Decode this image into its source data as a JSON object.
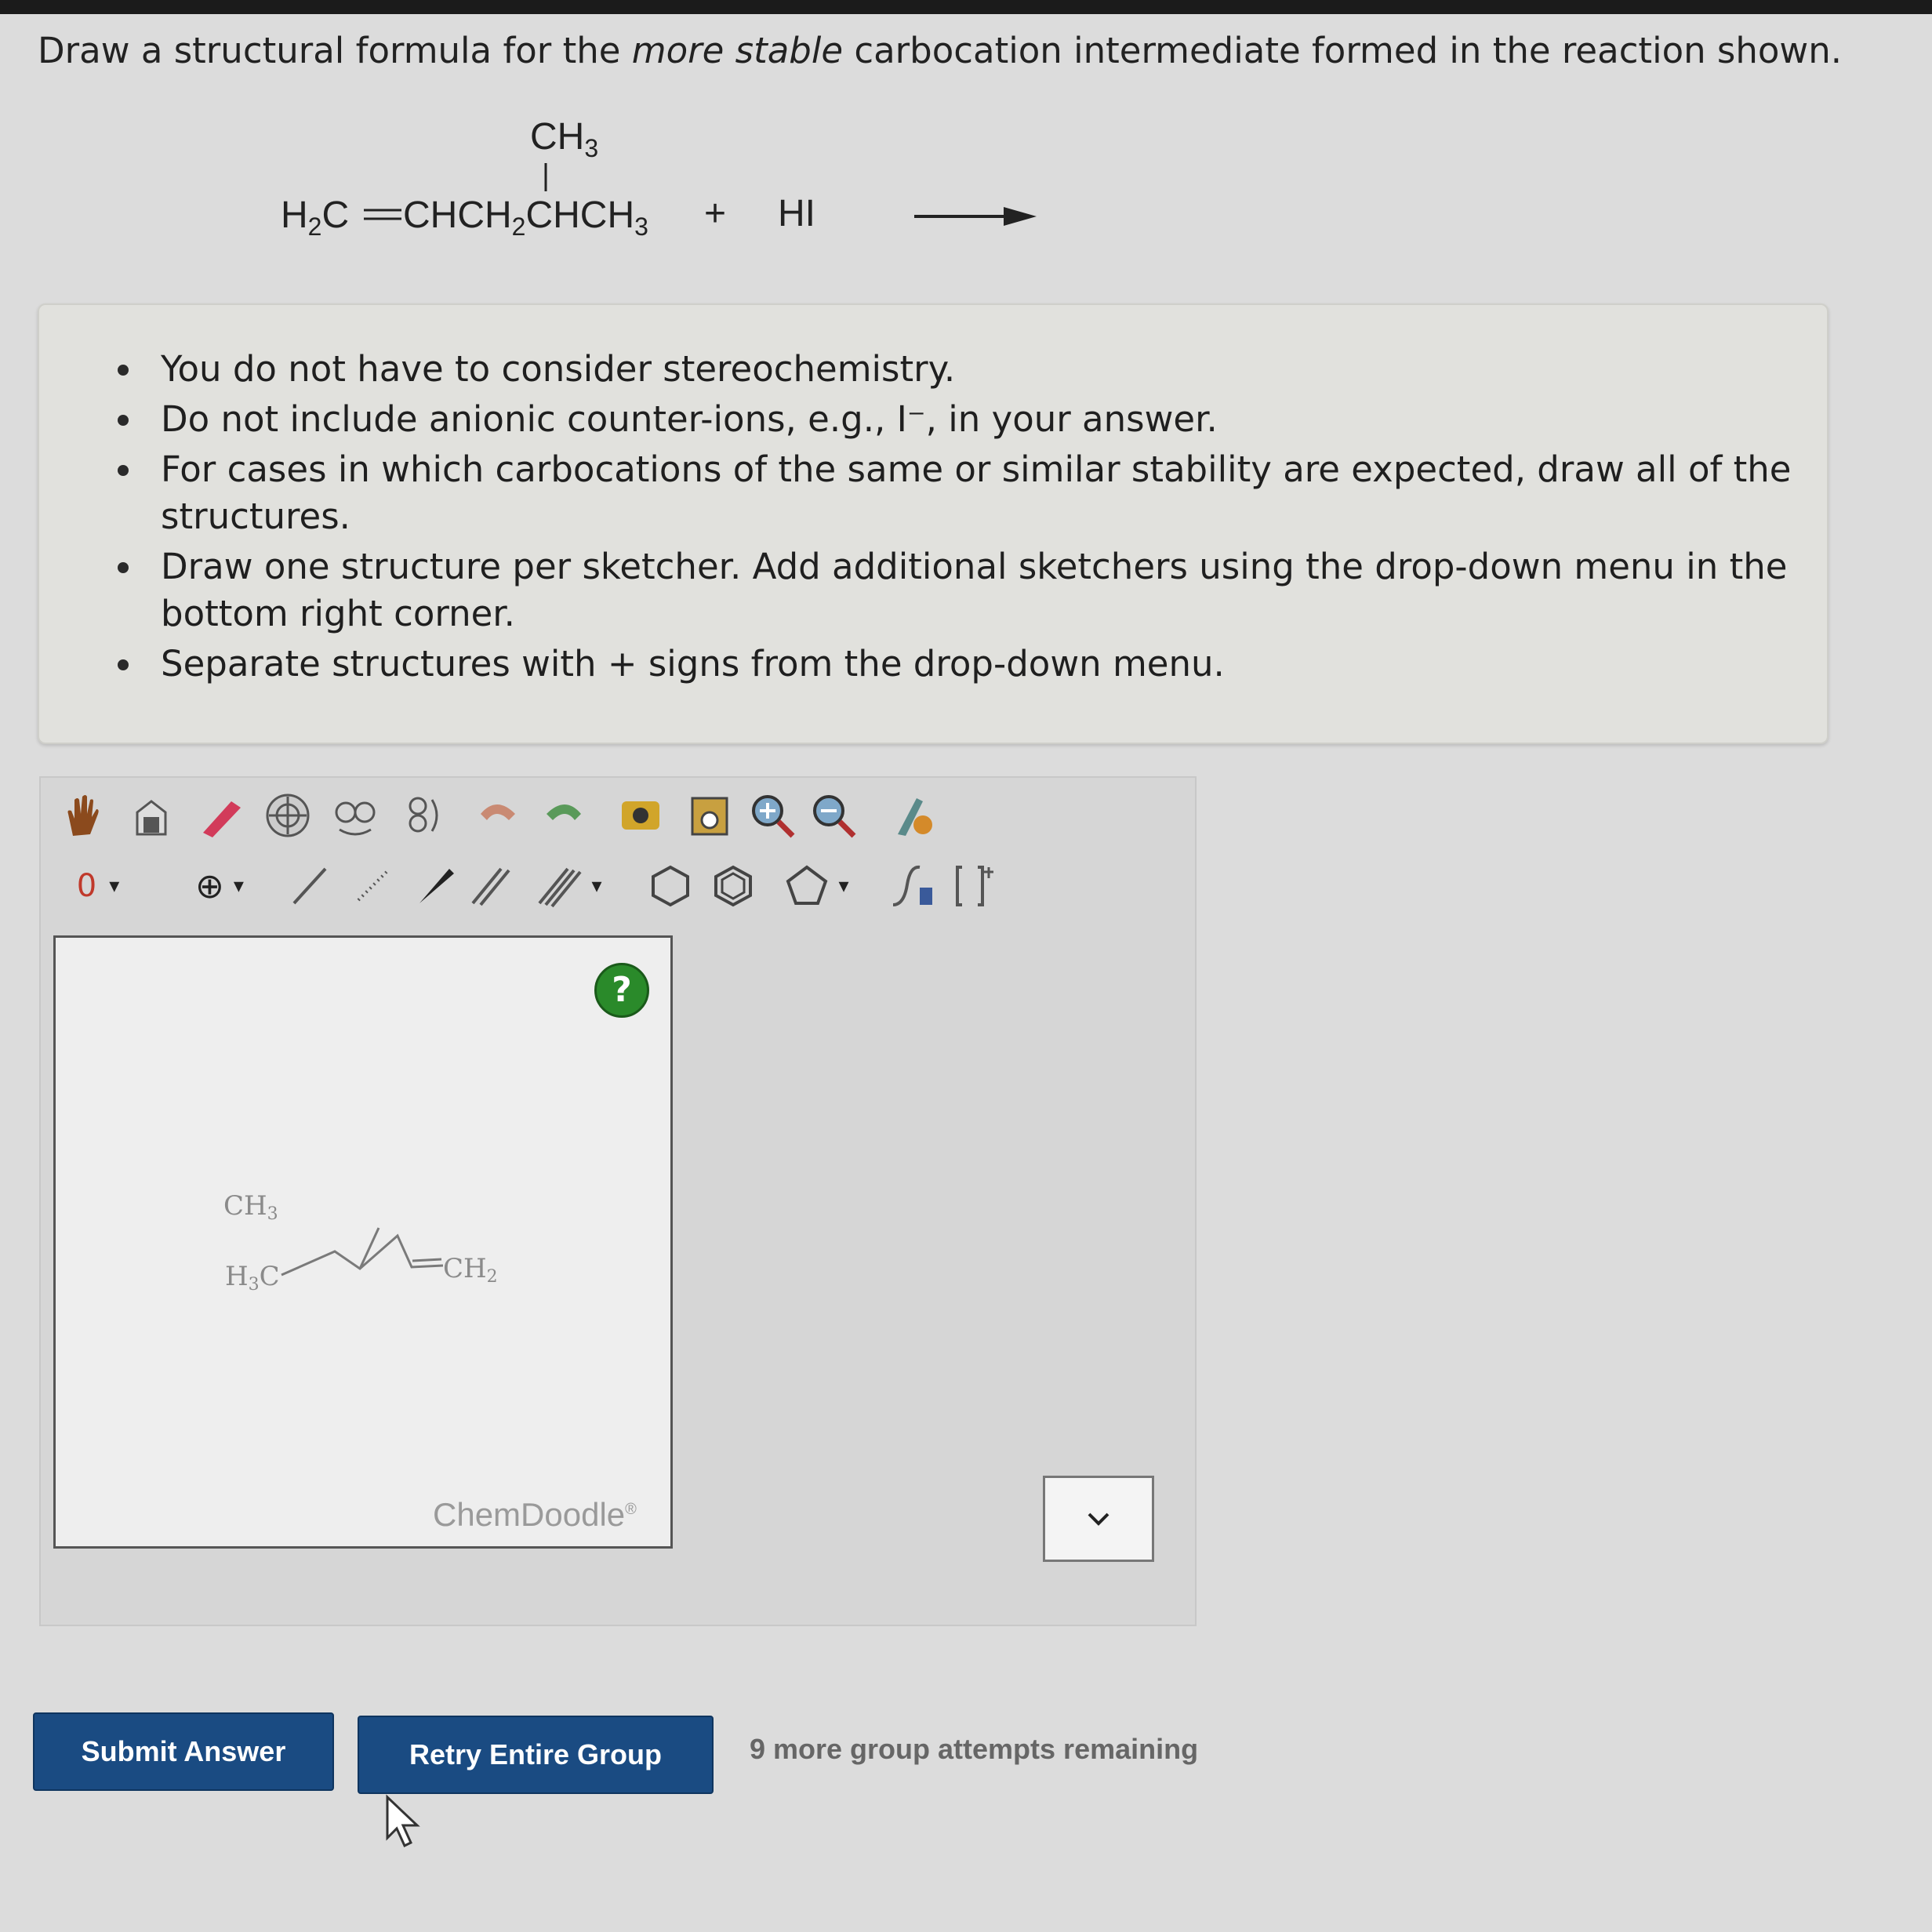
{
  "question": {
    "part1": "Draw a structural formula for the ",
    "emphasis": "more stable",
    "part2": " carbocation intermediate formed in the reaction shown."
  },
  "reaction": {
    "substituent": "CH3",
    "reactant": "H2C=CHCH2CHCH3",
    "plus": "+",
    "reagent": "HI"
  },
  "notes": [
    "You do not have to consider stereochemistry.",
    "Do not include anionic counter-ions, e.g., I⁻, in your answer.",
    "For cases in which carbocations of the same or similar stability are expected, draw all of the structures.",
    "Draw one structure per sketcher. Add additional sketchers using the drop-down menu in the bottom right corner.",
    "Separate structures with + signs from the drop-down menu."
  ],
  "toolbar_top_icons": [
    "hand-icon",
    "lasso-icon",
    "eraser-icon",
    "center-icon",
    "flip-horizontal-icon",
    "flip-vertical-icon",
    "undo-icon",
    "redo-icon",
    "copy-icon",
    "paste-icon",
    "zoom-in-icon",
    "zoom-out-icon",
    "clean-icon"
  ],
  "toolbar_bottom": {
    "charge_label": "0",
    "plus_charge_label": "⊕"
  },
  "sketcher": {
    "help": "?",
    "watermark": "ChemDoodle",
    "watermark_mark": "®",
    "structure_labels": {
      "left": "H3C",
      "top": "CH3",
      "right": "CH2"
    }
  },
  "buttons": {
    "submit": "Submit Answer",
    "retry": "Retry Entire Group"
  },
  "attempts_text": "9 more group attempts remaining"
}
